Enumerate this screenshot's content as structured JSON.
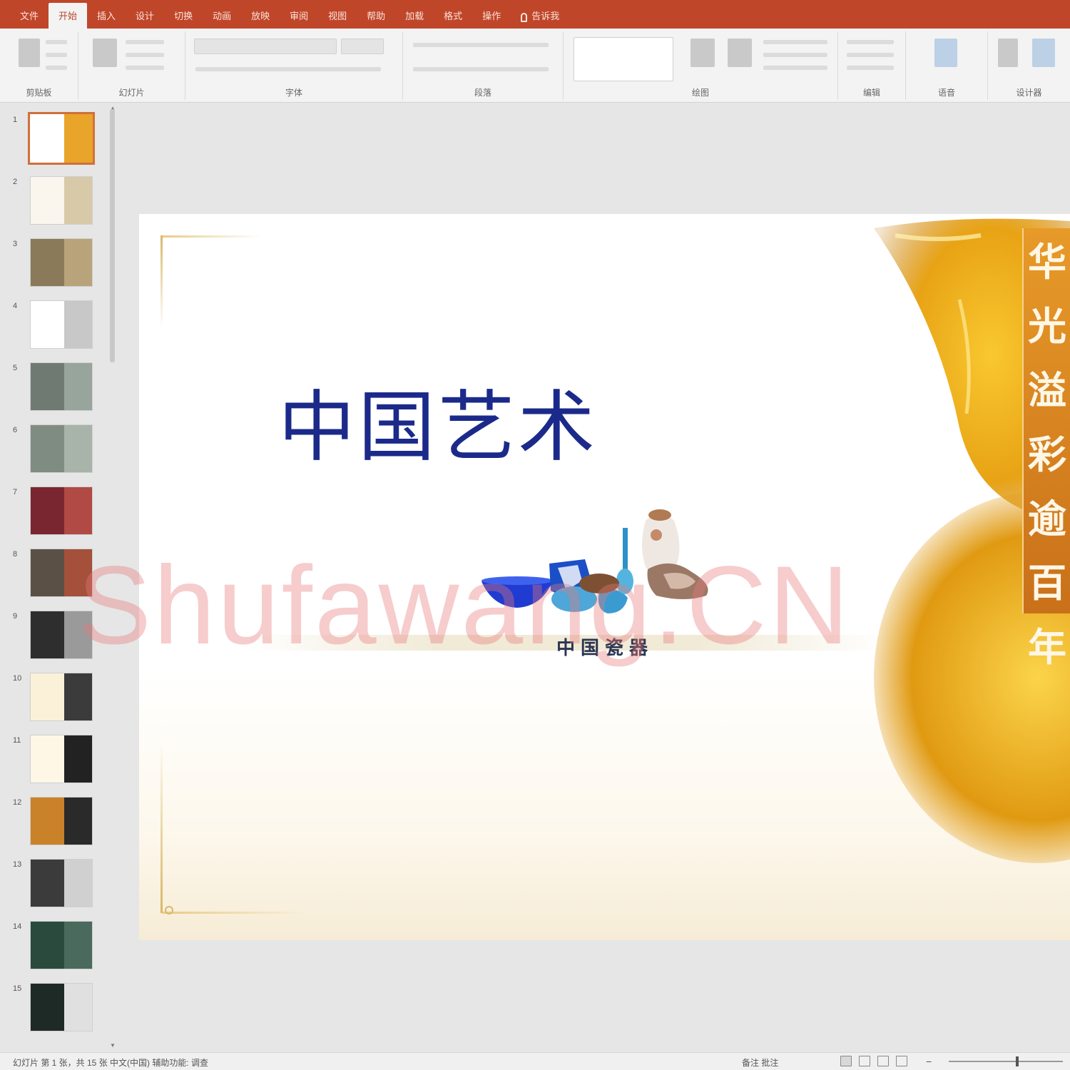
{
  "ribbon": {
    "tabs": [
      {
        "label": "文件",
        "active": false
      },
      {
        "label": "开始",
        "active": true
      },
      {
        "label": "插入",
        "active": false
      },
      {
        "label": "设计",
        "active": false
      },
      {
        "label": "切换",
        "active": false
      },
      {
        "label": "动画",
        "active": false
      },
      {
        "label": "放映",
        "active": false
      },
      {
        "label": "审阅",
        "active": false
      },
      {
        "label": "视图",
        "active": false
      },
      {
        "label": "帮助",
        "active": false
      },
      {
        "label": "加载",
        "active": false
      },
      {
        "label": "格式",
        "active": false
      },
      {
        "label": "操作",
        "active": false
      }
    ],
    "tellme": "告诉我",
    "groups": [
      {
        "label": "剪贴板"
      },
      {
        "label": "幻灯片"
      },
      {
        "label": "字体"
      },
      {
        "label": "段落"
      },
      {
        "label": "绘图"
      },
      {
        "label": "编辑"
      },
      {
        "label": "语音"
      },
      {
        "label": "设计器"
      }
    ]
  },
  "thumbnails": {
    "count": 15,
    "selected_index": 1
  },
  "slide": {
    "title": "中国艺术",
    "caption": "中国瓷器",
    "vertical_text": "华光溢彩逾百年",
    "watermark": "Shufawang.CN"
  },
  "status": {
    "left": "幻灯片 第 1 张，共 15 张   中文(中国)   辅助功能: 调查",
    "notes": "备注   批注"
  },
  "colors": {
    "accent": "#c0462a",
    "title": "#1b2a8a",
    "gold": "#e79a28"
  }
}
